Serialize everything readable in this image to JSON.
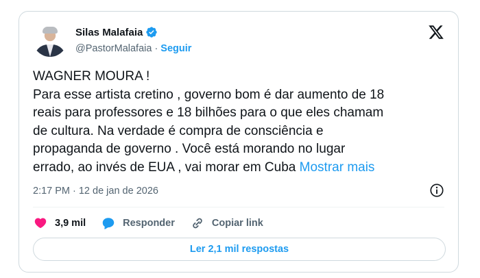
{
  "author": {
    "name": "Silas Malafaia",
    "handle": "@PastorMalafaia",
    "separator": "·",
    "follow_label": "Seguir"
  },
  "tweet": {
    "text": "WAGNER MOURA !\nPara esse artista cretino , governo bom é dar aumento de 18\nreais para professores e 18 bilhões para o que eles chamam\nde cultura. Na verdade é compra de consciência e\npropaganda de governo . Você está morando no lugar\nerrado, ao invés de EUA , vai morar em Cuba ",
    "show_more_label": "Mostrar mais",
    "time": "2:17 PM",
    "separator": "·",
    "date": "12 de jan de 2026"
  },
  "actions": {
    "like_count": "3,9 mil",
    "reply_label": "Responder",
    "copy_link_label": "Copiar link"
  },
  "read_replies_label": "Ler 2,1 mil respostas",
  "colors": {
    "accent": "#1d9bf0",
    "like": "#f91880",
    "text": "#0f1419",
    "muted": "#536471",
    "border": "#cfd9de"
  },
  "icons": [
    "verified-badge-icon",
    "x-logo-icon",
    "info-icon",
    "heart-icon",
    "reply-bubble-icon",
    "link-icon"
  ]
}
